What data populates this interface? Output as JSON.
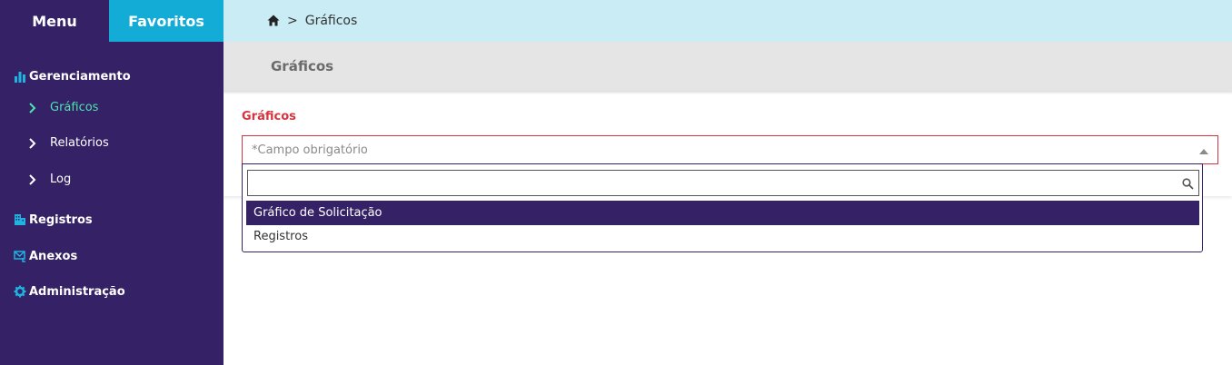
{
  "sidebar": {
    "tabs": {
      "menu": "Menu",
      "favorites": "Favoritos"
    },
    "sections": [
      {
        "label": "Gerenciamento",
        "icon": "bar-chart-icon",
        "items": [
          {
            "label": "Gráficos",
            "active": true
          },
          {
            "label": "Relatórios",
            "active": false
          },
          {
            "label": "Log",
            "active": false
          }
        ]
      },
      {
        "label": "Registros",
        "icon": "building-icon"
      },
      {
        "label": "Anexos",
        "icon": "mail-attachment-icon"
      },
      {
        "label": "Administração",
        "icon": "gear-icon"
      }
    ]
  },
  "breadcrumb": {
    "separator": ">",
    "current": "Gráficos"
  },
  "page": {
    "title": "Gráficos"
  },
  "form": {
    "field_label": "Gráficos",
    "select_placeholder": "*Campo obrigatório",
    "search_value": "",
    "options": [
      "Gráfico de Solicitação",
      "Registros"
    ],
    "selected_option": "Gráfico de Solicitação"
  },
  "colors": {
    "sidebar_bg": "#352165",
    "favorites_tab": "#12acd6",
    "active_item": "#4ee3b0",
    "topbar_bg": "#c9ecf5",
    "required_red": "#d6343f"
  }
}
